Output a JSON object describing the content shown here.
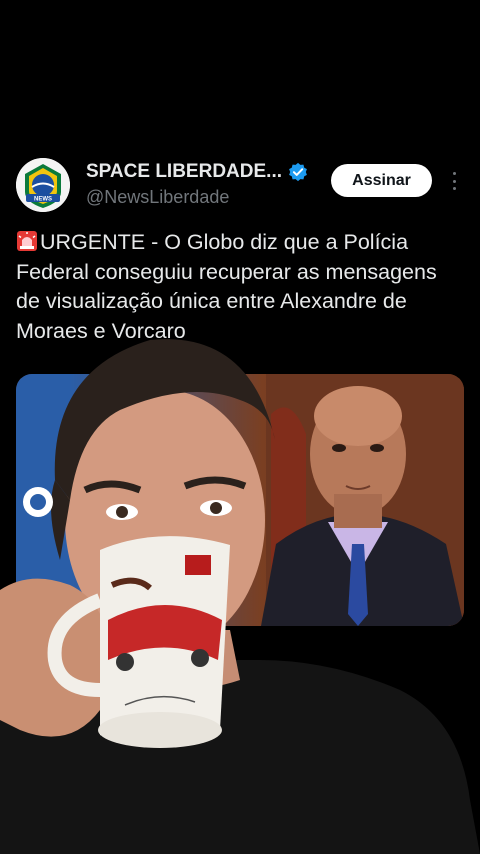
{
  "post": {
    "display_name": "SPACE LIBERDADE...",
    "handle": "@NewsLiberdade",
    "subscribe_label": "Assinar",
    "text_before_highlight": "URGENTE - O Globo diz que a Polícia Federal conseguiu recuperar as mensagens de visualização única entre Alexandre de Moraes e Vorcaro",
    "avatar_badge_text": "NEWS"
  },
  "icons": {
    "verified": "verified-badge-icon",
    "more": "more-options-icon",
    "siren": "siren-emoji-icon"
  },
  "colors": {
    "background": "#000000",
    "text": "#e7e9ea",
    "secondary_text": "#71767b",
    "verified_blue": "#1d9bf0",
    "button_bg": "#ffffff"
  }
}
